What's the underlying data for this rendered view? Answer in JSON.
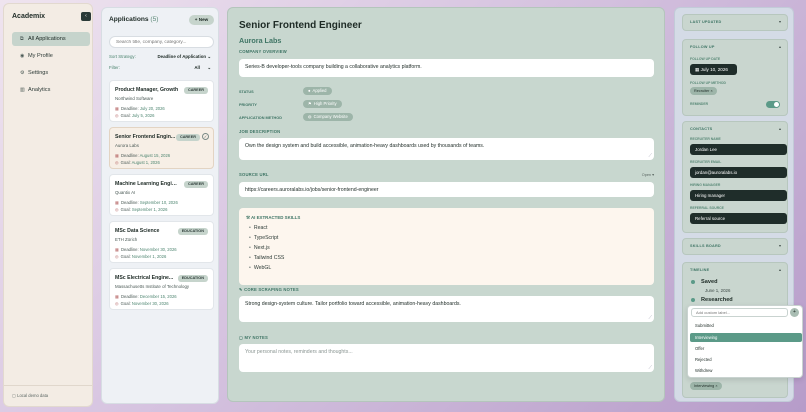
{
  "sidebar": {
    "brand": "Academix",
    "collapse_icon": "‹",
    "nav": [
      {
        "label": "All Applications",
        "icon": "⧉",
        "active": true
      },
      {
        "label": "My Profile",
        "icon": "◉"
      },
      {
        "label": "Settings",
        "icon": "⚙"
      },
      {
        "label": "Analytics",
        "icon": "▥"
      }
    ],
    "footer": "Local demo data"
  },
  "apps": {
    "title": "Applications",
    "count": "(5)",
    "new_button": "+ New",
    "search_placeholder": "Search title, company, category...",
    "sort_label": "Sort Strategy:",
    "sort_value": "Deadline of Application",
    "filter_label": "Filter:",
    "filter_value": "All",
    "cards": [
      {
        "title": "Product Manager, Growth",
        "org": "Northwind Software",
        "badge": "CAREER",
        "deadline_label": "Deadline:",
        "deadline": "July 20, 2026",
        "goal_label": "Goal:",
        "goal": "July 5, 2026"
      },
      {
        "title": "Senior Frontend Engin...",
        "org": "Aurora Labs",
        "badge": "CAREER",
        "deadline_label": "Deadline:",
        "deadline": "August 15, 2026",
        "goal_label": "Goal:",
        "goal": "August 1, 2026"
      },
      {
        "title": "Machine Learning Engineer",
        "org": "Quantix AI",
        "badge": "CAREER",
        "deadline_label": "Deadline:",
        "deadline": "September 10, 2026",
        "goal_label": "Goal:",
        "goal": "September 1, 2026"
      },
      {
        "title": "MSc Data Science",
        "org": "ETH Zürich",
        "badge": "EDUCATION",
        "deadline_label": "Deadline:",
        "deadline": "November 30, 2026",
        "goal_label": "Goal:",
        "goal": "November 1, 2026"
      },
      {
        "title": "MSc Electrical Engine...",
        "org": "Massachusetts Institute of Technology",
        "badge": "EDUCATION",
        "deadline_label": "Deadline:",
        "deadline": "December 15, 2026",
        "goal_label": "Goal:",
        "goal": "November 30, 2026"
      }
    ]
  },
  "detail": {
    "title": "Senior Frontend Engineer",
    "company": "Aurora Labs",
    "overview_label": "COMPANY OVERVIEW",
    "overview": "Series-B developer-tools company building a collaborative analytics platform.",
    "status_label": "STATUS",
    "status": "Applied",
    "priority_label": "PRIORITY",
    "priority": "High Priority",
    "method_label": "APPLICATION METHOD",
    "method": "Company Website",
    "jd_label": "JOB DESCRIPTION",
    "jd": "Own the design system and build accessible, animation-heavy dashboards used by thousands of teams.",
    "source_label": "SOURCE URL",
    "source_toggle": "Open ▾",
    "source": "https://careers.auroralabs.io/jobs/senior-frontend-engineer",
    "skills_label": "AI EXTRACTED SKILLS",
    "skills": [
      "React",
      "TypeScript",
      "Next.js",
      "Tailwind CSS",
      "WebGL"
    ],
    "scraping_label": "CORE SCRAPING NOTES",
    "scraping": "Strong design-system culture. Tailor portfolio toward accessible, animation-heavy dashboards.",
    "notes_label": "MY NOTES",
    "notes_placeholder": "Your personal notes, reminders and thoughts..."
  },
  "right": {
    "last_updated": "LAST UPDATED",
    "follow_up": "FOLLOW UP",
    "follow_up_date_label": "FOLLOW UP DATE",
    "follow_up_date": "July 10, 2026",
    "follow_up_method_label": "FOLLOW UP METHOD",
    "follow_up_method": "Recruiter",
    "reminder_label": "REMINDER",
    "contacts": "CONTACTS",
    "recruiter_name_label": "RECRUITER NAME",
    "recruiter_name": "Jordan Lee",
    "recruiter_email_label": "RECRUITER EMAIL",
    "recruiter_email": "jordan@auroralabs.io",
    "hiring_manager_label": "HIRING MANAGER",
    "hiring_manager": "Hiring manager",
    "referral_label": "REFERRAL SOURCE",
    "referral": "Referral source",
    "skills_board": "SKILLS BOARD",
    "timeline": "TIMELINE",
    "timeline_items": [
      {
        "label": "Saved",
        "date": "June 1, 2026"
      },
      {
        "label": "Researched",
        "date": ""
      }
    ],
    "tag_bottom": "Interviewing",
    "dropdown": {
      "placeholder": "Add custom label...",
      "add_icon": "+",
      "options": [
        "Submitted",
        "Interviewing",
        "Offer",
        "Rejected",
        "Withdrew"
      ],
      "highlighted": "Interviewing"
    }
  }
}
